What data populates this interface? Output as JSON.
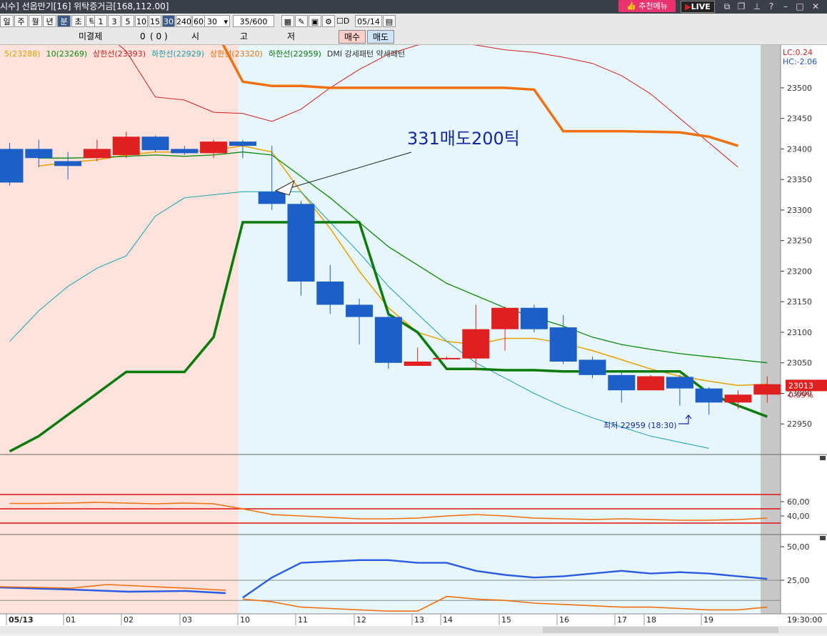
{
  "title_bar": {
    "text": "시수] 선옵만기[16] 위탁증거금[168,112.00]",
    "recommend_label": "추천메뉴",
    "live_label": "LIVE"
  },
  "toolbar": {
    "period_buttons": [
      "일",
      "주",
      "월",
      "년",
      "분",
      "초",
      "틱"
    ],
    "active_period": "분",
    "interval_buttons": [
      "1",
      "3",
      "5",
      "10",
      "15",
      "30",
      "240",
      "60"
    ],
    "active_interval": "30",
    "interval_select": "30",
    "count_value": "35",
    "count_total": "/600",
    "date_value": "05/14",
    "checkbox_label": "D"
  },
  "order_bar": {
    "unsettled_label": "미결제",
    "unsettled_value": "0",
    "paren_value": "(     0     )",
    "labels": [
      "시",
      "고",
      "저"
    ],
    "buy_label": "매수",
    "sell_label": "매도"
  },
  "legend": [
    {
      "text": "5(23288)",
      "color": "#e8a000"
    },
    {
      "text": "10(23269)",
      "color": "#0a8a0a"
    },
    {
      "text": "상한선(23393)",
      "color": "#d02020"
    },
    {
      "text": "하한선(22929)",
      "color": "#1aa0b0"
    },
    {
      "text": "상한선(23320)",
      "color": "#f07010"
    },
    {
      "text": "하한선(22959)",
      "color": "#0a7a0a"
    },
    {
      "text": "DMI 강세패턴 약세패턴",
      "color": "#333333"
    }
  ],
  "annotations": {
    "sell_signal": "331매도200틱",
    "low_label": "최저 22959 (18:30)"
  },
  "price_axis": {
    "lc_label": "LC:0.24",
    "hc_label": "HC:-2.06",
    "current_price": "23013",
    "current_change": "0.09%"
  },
  "colors": {
    "up": "#e02020",
    "down": "#1c5fc8",
    "past_bg": "#fde3db",
    "today_bg": "#e6f6fb"
  },
  "x_labels": [
    "05/13",
    "01",
    "02",
    "03",
    "10",
    "11",
    "12",
    "13",
    "14",
    "15",
    "16",
    "17",
    "18",
    "19"
  ],
  "time_label": "19:30:00",
  "chart_data": [
    {
      "type": "candlestick",
      "title": "",
      "ylim": [
        22900,
        23570
      ],
      "y_ticks": [
        22950,
        23000,
        23050,
        23100,
        23150,
        23200,
        23250,
        23300,
        23350,
        23400,
        23450,
        23500
      ],
      "candles": [
        {
          "o": 23400,
          "h": 23410,
          "l": 23340,
          "c": 23345
        },
        {
          "o": 23400,
          "h": 23415,
          "l": 23370,
          "c": 23385
        },
        {
          "o": 23380,
          "h": 23395,
          "l": 23350,
          "c": 23372
        },
        {
          "o": 23385,
          "h": 23415,
          "l": 23380,
          "c": 23400
        },
        {
          "o": 23390,
          "h": 23428,
          "l": 23385,
          "c": 23420
        },
        {
          "o": 23420,
          "h": 23422,
          "l": 23395,
          "c": 23398
        },
        {
          "o": 23400,
          "h": 23405,
          "l": 23390,
          "c": 23393
        },
        {
          "o": 23393,
          "h": 23415,
          "l": 23385,
          "c": 23412
        },
        {
          "o": 23412,
          "h": 23415,
          "l": 23385,
          "c": 23405
        },
        {
          "o": 23330,
          "h": 23405,
          "l": 23300,
          "c": 23310
        },
        {
          "o": 23310,
          "h": 23315,
          "l": 23160,
          "c": 23183
        },
        {
          "o": 23183,
          "h": 23210,
          "l": 23130,
          "c": 23145
        },
        {
          "o": 23145,
          "h": 23155,
          "l": 23080,
          "c": 23125
        },
        {
          "o": 23125,
          "h": 23135,
          "l": 23040,
          "c": 23050
        },
        {
          "o": 23045,
          "h": 23075,
          "l": 23045,
          "c": 23052
        },
        {
          "o": 23058,
          "h": 23060,
          "l": 23055,
          "c": 23058
        },
        {
          "o": 23057,
          "h": 23145,
          "l": 23038,
          "c": 23105
        },
        {
          "o": 23105,
          "h": 23142,
          "l": 23070,
          "c": 23140
        },
        {
          "o": 23140,
          "h": 23145,
          "l": 23100,
          "c": 23105
        },
        {
          "o": 23108,
          "h": 23128,
          "l": 23048,
          "c": 23052
        },
        {
          "o": 23055,
          "h": 23060,
          "l": 23025,
          "c": 23030
        },
        {
          "o": 23030,
          "h": 23035,
          "l": 22985,
          "c": 23005
        },
        {
          "o": 23005,
          "h": 23030,
          "l": 23005,
          "c": 23028
        },
        {
          "o": 23027,
          "h": 23030,
          "l": 22980,
          "c": 23008
        },
        {
          "o": 23008,
          "h": 23010,
          "l": 22965,
          "c": 22985
        },
        {
          "o": 22985,
          "h": 23005,
          "l": 22975,
          "c": 22998
        },
        {
          "o": 22998,
          "h": 23028,
          "l": 22985,
          "c": 23015
        }
      ],
      "series": [
        {
          "name": "5",
          "color": "#e8a000",
          "values": [
            null,
            23372,
            23378,
            23382,
            23390,
            23395,
            23395,
            23398,
            23405,
            23395,
            23330,
            23270,
            23200,
            23140,
            23100,
            23085,
            23080,
            23090,
            23090,
            23082,
            23070,
            23055,
            23040,
            23028,
            23020,
            23013,
            23015
          ]
        },
        {
          "name": "10",
          "color": "#0a8a0a",
          "values": [
            null,
            23385,
            23385,
            23386,
            23388,
            23390,
            23388,
            23390,
            23395,
            23390,
            23355,
            23320,
            23280,
            23240,
            23210,
            23180,
            23160,
            23140,
            23125,
            23110,
            23092,
            23080,
            23072,
            23065,
            23060,
            23055,
            23050
          ]
        },
        {
          "name": "상한선",
          "color": "#d02020",
          "values": [
            null,
            null,
            null,
            23600,
            23560,
            23485,
            23480,
            23460,
            23458,
            23445,
            23465,
            23500,
            23530,
            23555,
            23570,
            23575,
            23570,
            23562,
            23558,
            23550,
            23540,
            23520,
            23490,
            23450,
            23410,
            23370,
            null
          ]
        },
        {
          "name": "하한선",
          "color": "#1aa0b0",
          "values": [
            23085,
            23135,
            23175,
            23205,
            23225,
            23290,
            23320,
            23325,
            23330,
            23330,
            23330,
            23280,
            23230,
            23175,
            23130,
            23085,
            23050,
            23025,
            23000,
            22978,
            22960,
            22945,
            22930,
            22920,
            22910,
            null,
            null
          ]
        },
        {
          "name": "상한선",
          "color": "#f07010",
          "values": [
            null,
            null,
            null,
            null,
            null,
            null,
            null,
            23600,
            23510,
            23503,
            23503,
            23500,
            23500,
            23500,
            23500,
            23500,
            23500,
            23500,
            23497,
            23429,
            23429,
            23429,
            23428,
            23427,
            23420,
            23405,
            null
          ]
        },
        {
          "name": "하한선",
          "color": "#0a7a0a",
          "values": [
            22905,
            22930,
            22965,
            23000,
            23035,
            23035,
            23035,
            23092,
            23280,
            23280,
            23280,
            23280,
            23280,
            23130,
            23100,
            23040,
            23040,
            23038,
            23038,
            23036,
            23036,
            23036,
            23036,
            23036,
            23000,
            22980,
            22962
          ]
        }
      ]
    },
    {
      "type": "line",
      "title": "",
      "y_ticks": [
        40.0,
        60.0
      ],
      "tick_labels": [
        "60,00",
        "40,00"
      ],
      "reference_lines": [
        70,
        50,
        30
      ],
      "series": [
        {
          "color": "#f07010",
          "values": [
            57.5,
            57.5,
            58,
            59,
            58,
            57,
            58,
            57,
            50,
            42,
            40,
            38,
            36,
            36,
            37,
            40,
            42,
            40,
            37,
            36,
            35,
            36,
            35,
            34,
            34,
            35,
            37
          ]
        }
      ]
    },
    {
      "type": "line",
      "title": "",
      "y_ticks": [
        25.0,
        50.0
      ],
      "tick_labels": [
        "50,00",
        "25,00"
      ],
      "reference_lines": [
        25,
        10
      ],
      "series": [
        {
          "color": "#2a5be0",
          "values": [
            null,
            null,
            null,
            null,
            null,
            null,
            null,
            null,
            12,
            27,
            38,
            39,
            40,
            40,
            38,
            38,
            32,
            29,
            27,
            28,
            30,
            32,
            30,
            31,
            30,
            28,
            26
          ]
        },
        {
          "color": "#f07010",
          "values": [
            null,
            null,
            null,
            null,
            null,
            null,
            null,
            null,
            11,
            9,
            5,
            4,
            3,
            2,
            2,
            13,
            11,
            10,
            8,
            7,
            6,
            5,
            5,
            4,
            3,
            3,
            5
          ]
        }
      ]
    }
  ]
}
